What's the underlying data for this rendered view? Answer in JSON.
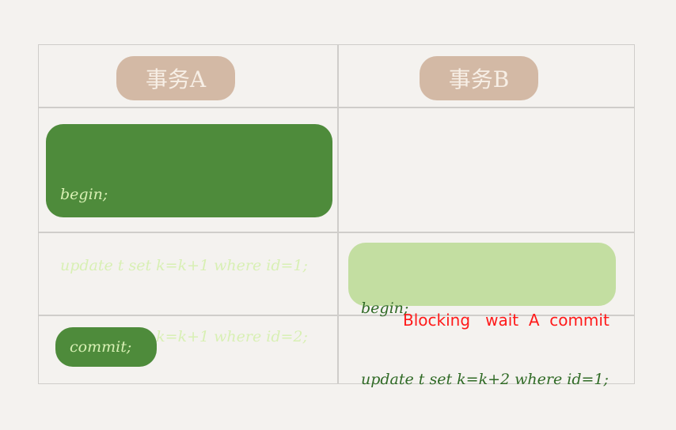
{
  "headers": {
    "tx_a": "事务A",
    "tx_b": "事务B"
  },
  "tx_a_step1": [
    "begin;",
    "update t set k=k+1 where id=1;",
    "update t set k=k+1 where id=2;"
  ],
  "tx_b_step2": [
    "begin;",
    "update t set k=k+2 where id=1;"
  ],
  "tx_a_step3": "commit;",
  "annotation": "Blocking   wait  A  commit",
  "colors": {
    "header_pill": "#d3b9a5",
    "tx_a_block": "#4e8b3b",
    "tx_b_block": "#c3dea1",
    "annotation": "#ff1a1a",
    "grid_line": "#cfcdca"
  }
}
